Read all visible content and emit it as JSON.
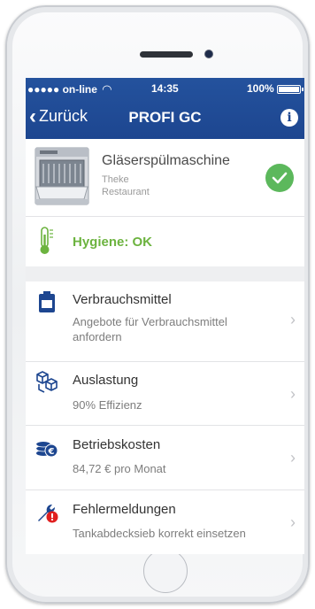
{
  "status": {
    "carrier": "●●●●● on-line",
    "time": "14:35",
    "battery": "100%"
  },
  "nav": {
    "back_label": "Zurück",
    "title": "PROFI GC",
    "info_icon": "info-icon"
  },
  "device": {
    "name": "Gläserspülmaschine",
    "location1": "Theke",
    "location2": "Restaurant",
    "status_icon": "checkmark-icon"
  },
  "hygiene": {
    "label": "Hygiene: OK",
    "icon": "thermometer-icon"
  },
  "items": [
    {
      "title": "Verbrauchsmittel",
      "desc": "Angebote für Verbrauchsmittel anfordern",
      "icon": "canister-icon"
    },
    {
      "title": "Auslastung",
      "desc": "90% Effizienz",
      "icon": "boxes-icon"
    },
    {
      "title": "Betriebskosten",
      "desc": "84,72 € pro Monat",
      "icon": "coins-icon"
    },
    {
      "title": "Fehlermeldungen",
      "desc": "Tankabdecksieb korrekt einsetzen",
      "icon": "wrench-alert-icon"
    }
  ],
  "colors": {
    "nav_blue": "#1d4690",
    "ok_green": "#5cb85c",
    "hygiene_green": "#6cb33f",
    "error_red": "#e02020"
  }
}
